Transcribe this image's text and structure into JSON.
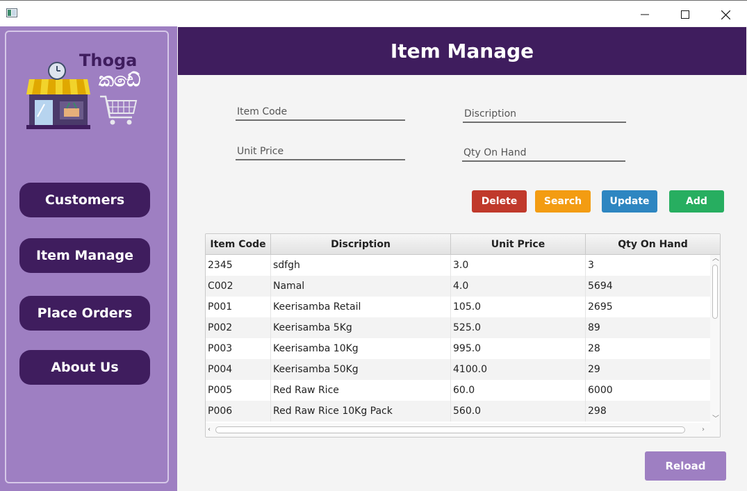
{
  "window": {
    "icons": {
      "app": "app-window-icon",
      "minimize": "minimize-icon",
      "maximize": "maximize-icon",
      "close": "close-icon"
    }
  },
  "logo": {
    "brand": "Thoga",
    "brand_sinhala": "කඩේ",
    "store_icon": "store-icon",
    "cart_icon": "shopping-cart-icon",
    "clock_icon": "clock-icon"
  },
  "sidebar": {
    "items": [
      {
        "label": "Customers"
      },
      {
        "label": "Item Manage"
      },
      {
        "label": "Place Orders"
      },
      {
        "label": "About Us"
      }
    ]
  },
  "header": {
    "title": "Item Manage"
  },
  "form": {
    "item_code_placeholder": "Item Code",
    "description_placeholder": "Discription",
    "unit_price_placeholder": "Unit Price",
    "qty_placeholder": "Qty On Hand"
  },
  "actions": {
    "delete": "Delete",
    "search": "Search",
    "update": "Update",
    "add": "Add",
    "reload": "Reload"
  },
  "colors": {
    "primary": "#3f1d5e",
    "sidebar": "#9e7fc2",
    "delete": "#c0392b",
    "search": "#f39c12",
    "update": "#2e86c1",
    "add": "#27ae60"
  },
  "table": {
    "columns": [
      "Item Code",
      "Discription",
      "Unit Price",
      "Qty On Hand"
    ],
    "rows": [
      [
        "2345",
        "sdfgh",
        "3.0",
        "3"
      ],
      [
        "C002",
        "Namal",
        "4.0",
        "5694"
      ],
      [
        "P001",
        "Keerisamba Retail",
        "105.0",
        "2695"
      ],
      [
        "P002",
        "Keerisamba 5Kg",
        "525.0",
        "89"
      ],
      [
        "P003",
        "Keerisamba 10Kg",
        "995.0",
        "28"
      ],
      [
        "P004",
        "Keerisamba 50Kg",
        "4100.0",
        "29"
      ],
      [
        "P005",
        "Red Raw Rice",
        "60.0",
        "6000"
      ],
      [
        "P006",
        "Red Raw Rice 10Kg Pack",
        "560.0",
        "298"
      ]
    ]
  }
}
